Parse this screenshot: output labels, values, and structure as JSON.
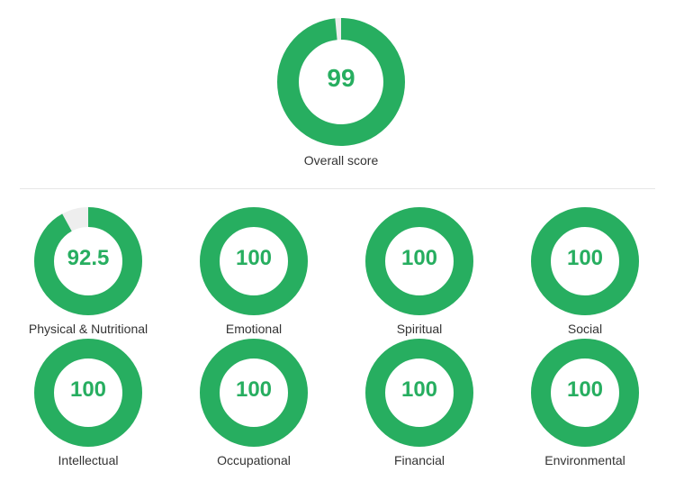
{
  "colors": {
    "accent": "#27ae60",
    "track": "#eeeeee"
  },
  "overall": {
    "label": "Overall score",
    "value_text": "99",
    "value": 99
  },
  "categories": [
    {
      "label": "Physical & Nutritional",
      "value_text": "92.5",
      "value": 92.5
    },
    {
      "label": "Emotional",
      "value_text": "100",
      "value": 100
    },
    {
      "label": "Spiritual",
      "value_text": "100",
      "value": 100
    },
    {
      "label": "Social",
      "value_text": "100",
      "value": 100
    },
    {
      "label": "Intellectual",
      "value_text": "100",
      "value": 100
    },
    {
      "label": "Occupational",
      "value_text": "100",
      "value": 100
    },
    {
      "label": "Financial",
      "value_text": "100",
      "value": 100
    },
    {
      "label": "Environmental",
      "value_text": "100",
      "value": 100
    }
  ]
}
